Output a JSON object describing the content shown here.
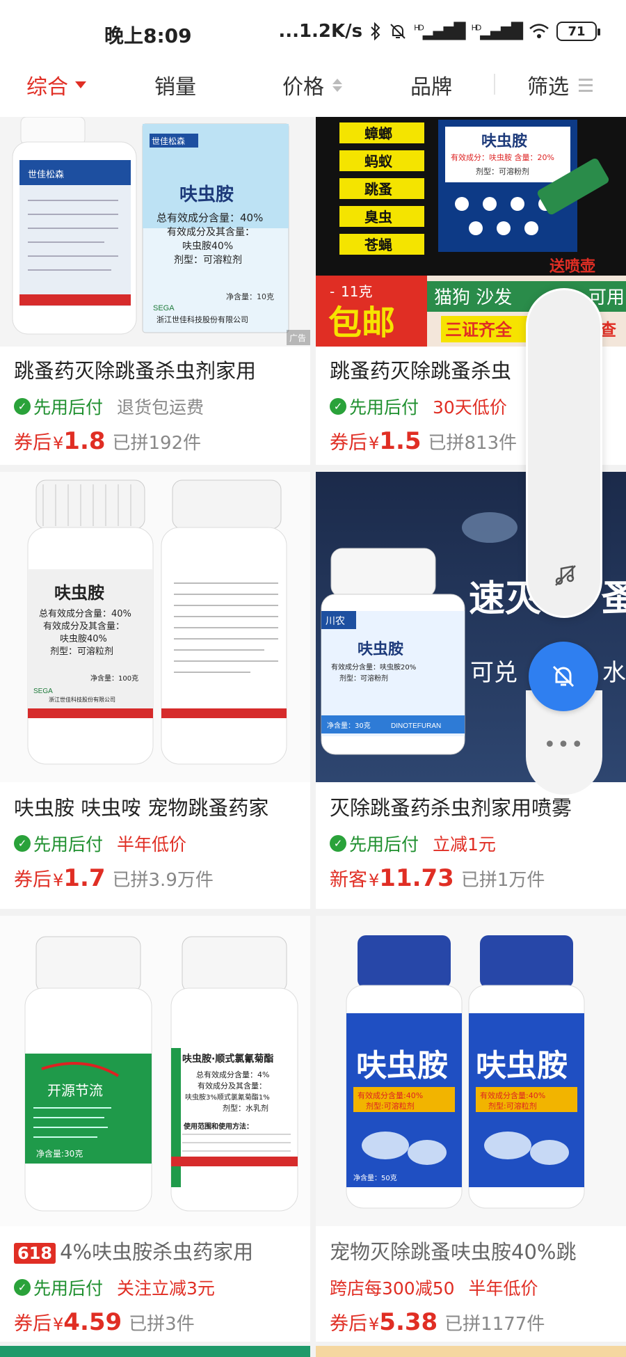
{
  "status_bar": {
    "time": "晚上8:09",
    "net_speed": "...1.2K/s",
    "battery": "71",
    "signal1": "HD",
    "signal2": "HD"
  },
  "sort_bar": {
    "items": [
      {
        "label": "综合",
        "active": true
      },
      {
        "label": "销量"
      },
      {
        "label": "价格"
      },
      {
        "label": "品牌"
      },
      {
        "label": "筛选"
      }
    ]
  },
  "products": [
    {
      "title": "跳蚤药灭除跳蚤杀虫剂家用",
      "pay_later": "先用后付",
      "tag": "退货包运费",
      "price_label": "券后",
      "currency": "¥",
      "price": "1.8",
      "sold": "已拼192件",
      "image": {
        "brand": "世佳松森",
        "product": "呋虫胺",
        "content": "总有效成分含量：40%",
        "active": "有效成分及其含量：",
        "active2": "呋虫胺40%",
        "form": "剂型：可溶粒剂",
        "maker": "浙江世佳科技股份有限公司",
        "net": "净含量：10克",
        "ad": "广告",
        "sega": "SEGA"
      }
    },
    {
      "title": "跳蚤药灭除跳蚤杀虫",
      "pay_later": "先用后付",
      "tag": "30天低价",
      "price_label": "券后",
      "currency": "¥",
      "price": "1.5",
      "sold": "已拼813件",
      "image": {
        "pests": [
          "蟑螂",
          "蚂蚁",
          "跳蚤",
          "臭虫",
          "苍蝇"
        ],
        "product": "呋虫胺",
        "content": "有效成分：呋虫胺 含量：20%",
        "form": "剂型：可溶粉剂",
        "gift": "送喷壶",
        "weight": "11克",
        "free_ship": "包邮",
        "pets": "猫狗 沙发",
        "pets_tail": "可用",
        "certs": "三证齐全",
        "certs_tail": "查"
      }
    },
    {
      "title": "呋虫胺 呋虫咹 宠物跳蚤药家",
      "pay_later": "先用后付",
      "tag": "半年低价",
      "price_label": "券后",
      "currency": "¥",
      "price": "1.7",
      "sold": "已拼3.9万件",
      "image": {
        "product": "呋虫胺",
        "content": "总有效成分含量：40%",
        "active": "有效成分及其含量：",
        "active2": "呋虫胺40%",
        "form": "剂型：可溶粒剂",
        "net": "净含量：100克",
        "maker": "浙江世佳科技股份有限公司",
        "sega": "SEGA"
      }
    },
    {
      "title": "灭除跳蚤药杀虫剂家用喷雾",
      "pay_later": "先用后付",
      "tag": "立减1元",
      "price_label": "新客",
      "currency": "¥",
      "price": "11.73",
      "sold": "已拼1万件",
      "image": {
        "headline": "速灭",
        "headline_tail": "蚤",
        "sub": "可兑",
        "sub_tail": "水",
        "brand": "川农",
        "product": "呋虫胺",
        "content": "有效成分含量：呋虫胺20%",
        "form": "剂型：可溶粉剂",
        "net": "净含量：30克",
        "en": "DINOTEFURAN"
      }
    },
    {
      "badge": "618",
      "title": "4%呋虫胺杀虫药家用",
      "pay_later": "先用后付",
      "tag": "关注立减3元",
      "price_label": "券后",
      "currency": "¥",
      "price": "4.59",
      "sold": "已拼3件",
      "image": {
        "brand": "开源节流",
        "product": "呋虫胺·顺式氯氰菊酯",
        "content": "总有效成分含量：4%",
        "active": "有效成分及其含量：",
        "active2": "呋虫胺3%顺式氯氰菊酯1%",
        "form": "剂型：水乳剂",
        "net": "净含量:30克",
        "usage": "使用范围和使用方法："
      }
    },
    {
      "title": "宠物灭除跳蚤呋虫胺40%跳",
      "tag_red1": "跨店每300减50",
      "tag": "半年低价",
      "price_label": "券后",
      "currency": "¥",
      "price": "5.38",
      "sold": "已拼1177件",
      "image": {
        "product": "呋虫胺",
        "content": "有效成分含量:40%",
        "form": "剂型:可溶粒剂",
        "net": "净含量：50克"
      }
    }
  ],
  "colors": {
    "accent_red": "#e02e24",
    "pay_green": "#1e8f2e",
    "floating_blue": "#2f7ff0"
  }
}
